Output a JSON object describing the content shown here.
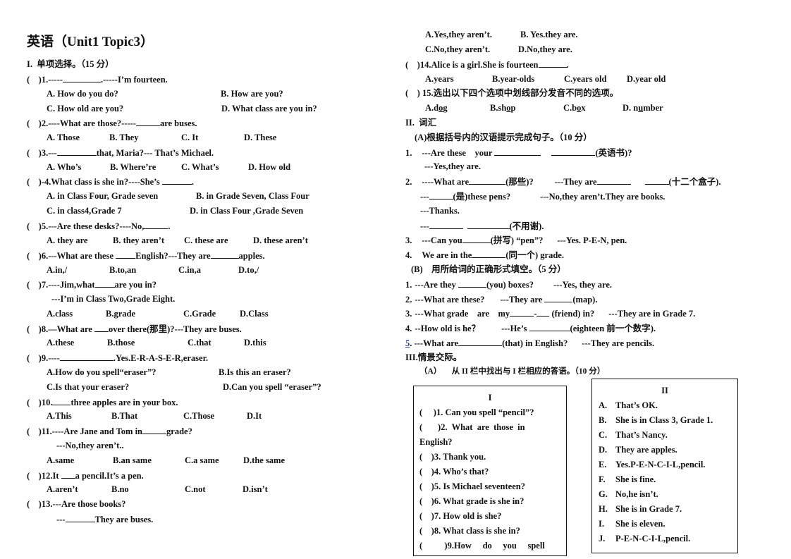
{
  "title": "英语（Unit1 Topic3）",
  "section1": {
    "heading": "I.  单项选择。（15 分）",
    "questions": [
      {
        "stem_a": "(    )1.-----",
        "stem_b": ".-----I’m fourteen.",
        "options": [
          "A. How do you do?",
          "B. How are you?",
          "C. How old are you?",
          "D. What class are you in?"
        ]
      },
      {
        "stem_a": "(    )2.----What are those?-----",
        "stem_b": "are buses.",
        "options": [
          "A. Those",
          "B. They",
          "C. It",
          "D. These"
        ]
      },
      {
        "stem_a": "(    )3.---",
        "stem_b": "that, Maria?--- That’s Michael.",
        "options": [
          "A. Who’s",
          "B. Where’re",
          "C. What’s",
          "D. How old"
        ]
      },
      {
        "stem_a": "(    )-4.What class is she in?----She’s ",
        "stem_b": ".",
        "options": [
          "A. in Class Four, Grade seven",
          "B. in Grade Seven, Class Four",
          "C. in class4,Grade 7",
          "D. in Class Four ,Grade Seven"
        ]
      },
      {
        "stem_a": "(    )5.---Are these desks?----No,",
        "stem_b": ".",
        "options": [
          "A. they are",
          "B. they aren’t",
          "C. these are",
          "D. these aren’t"
        ]
      },
      {
        "stem_a": "(    )6.---What are these ",
        "stem_mid": "English?---They are",
        "stem_b": "apples.",
        "options": [
          "A.in,/",
          "B.to,an",
          "C.in,a",
          "D.to,/"
        ]
      },
      {
        "stem_a": "(    )7.----Jim,what",
        "stem_b": "are you in?",
        "reply": "---I’m in Class Two,Grade Eight.",
        "options": [
          "A.class",
          "B.grade",
          "C.Grade",
          "D.Class"
        ]
      },
      {
        "stem_a": "(    )8.—What are ",
        "stem_b": "over there(那里)?---They are buses.",
        "options": [
          "A.these",
          "B.those",
          "C.that",
          "D.this"
        ]
      },
      {
        "stem_a": "(    )9.----",
        "stem_b": ".Yes.E-R-A-S-E-R,eraser.",
        "options": [
          "A.How do you spell“eraser”?",
          "B.Is this an eraser?",
          "C.Is that your eraser?",
          "D.Can you spell “eraser”?"
        ]
      },
      {
        "stem_a": "(    )10.",
        "stem_b": "three apples are in your box.",
        "options": [
          "A.This",
          "B.That",
          "C.Those",
          "D.It"
        ]
      },
      {
        "stem_a": "(    )11.----Are Jane and Tom in",
        "stem_b": "grade?",
        "reply": "---No,they aren’t..",
        "options": [
          "A.same",
          "B.an same",
          "C.a same",
          "D.the same"
        ]
      },
      {
        "stem_a": "(    )12.It ",
        "stem_b": "a pencil.It’s a pen.",
        "options": [
          "A.aren’t",
          "B.no",
          "C.not",
          "D.isn’t"
        ]
      },
      {
        "stem_a": "(    )13.---Are those books?",
        "reply_a": "---",
        "reply_b": "They are buses.",
        "options": [
          "A.Yes,they aren’t.",
          "B. Yes.they are.",
          "C.No,they aren’t.",
          "D.No,they are."
        ]
      },
      {
        "stem_a": "(    )14.Alice is a girl.She is fourteen",
        "stem_b": ".",
        "options": [
          "A.years",
          "B.year-olds",
          "C.years old",
          "D.year old"
        ]
      },
      {
        "stem_a": "(    ) 15.选出以下四个选项中划线部分发音不同的选项。",
        "options": [
          {
            "pre": "A.d",
            "u": "o",
            "post": "g"
          },
          {
            "pre": "B.sh",
            "u": "o",
            "post": "p"
          },
          {
            "pre": "C.b",
            "u": "o",
            "post": "x"
          },
          {
            "pre": "D. n",
            "u": "u",
            "post": "mber"
          }
        ]
      }
    ]
  },
  "section2": {
    "heading": "II.  词汇",
    "partA": {
      "heading": "(A)根据括号内的汉语提示完成句子。（10 分）",
      "items": [
        {
          "num": "1.",
          "a": "---Are these    your ",
          "hint": "(英语书)?",
          "reply": "---Yes,they are."
        },
        {
          "num": "2.",
          "a": "----What are",
          "hint1": "(那些)?",
          "b": "---They are",
          "hint2": "(十二个盒子).",
          "line2_a": "---",
          "line2_hint": "(是)these pens?",
          "line2_b": "---No,they aren’t.They are books.",
          "line3": "---Thanks.",
          "line4_a": "---",
          "line4_hint": "(不用谢)."
        },
        {
          "num": "3.",
          "a": "---Can you",
          "hint": "(拼写) “pen”?",
          "b": "---Yes. P-E-N, pen."
        },
        {
          "num": "4.",
          "a": "We are in the",
          "hint": "(同一个) grade."
        }
      ]
    },
    "partB": {
      "heading": "(B)    用所给词的正确形式填空。（5 分）",
      "items": [
        {
          "num": "1.",
          "a": "---Are they ",
          "hint": "(you) boxes?",
          "b": "---Yes, they are."
        },
        {
          "num": "2.",
          "a": "---What are these?",
          "b": "---They are ",
          "hint": "(map)."
        },
        {
          "num": "3.",
          "a": "---What grade    are    my",
          "dash": "-",
          "hint": " (friend) in?",
          "b": "---They are in Grade 7."
        },
        {
          "num": "4.",
          "a": "--How old is he？",
          "b": "---He’s ",
          "hint": "(eighteen 前一个数字)."
        },
        {
          "num": "5",
          "a": ". ---What are",
          "hint": "(that) in English?",
          "b": "---They are pencils."
        }
      ]
    }
  },
  "section3": {
    "heading": "III.情景交际。",
    "partA": {
      "heading": "（A）     从 II 栏中找出与 I 栏相应的答语。（10 分）",
      "col1": {
        "header": "I",
        "items": [
          "(     )1. Can you spell “pencil”?",
          "(       )2.  What  are  those  in",
          "English?",
          "(    )3. Thank you.",
          "(    )4. Who’s that?",
          "(    )5. Is Michael seventeen?",
          "(    )6. What grade is she in?",
          "(    )7. How old is she?",
          "(    )8. What class is she in?",
          "(          )9.How     do     you     spell"
        ]
      },
      "col2": {
        "header": "II",
        "items": [
          {
            "letter": "A.",
            "text": "That’s OK."
          },
          {
            "letter": "B.",
            "text": "She is in Class 3, Grade 1."
          },
          {
            "letter": "C.",
            "text": "That’s Nancy."
          },
          {
            "letter": "D.",
            "text": "They are apples."
          },
          {
            "letter": "E.",
            "text": "Yes.P-E-N-C-I-L,pencil."
          },
          {
            "letter": "F.",
            "text": "She is fine."
          },
          {
            "letter": "G.",
            "text": "No,he isn’t."
          },
          {
            "letter": "H.",
            "text": "She is in Grade 7."
          },
          {
            "letter": "I.",
            "text": "She is eleven."
          },
          {
            "letter": "J.",
            "text": "P-E-N-C-I-L,pencil."
          }
        ]
      }
    }
  }
}
